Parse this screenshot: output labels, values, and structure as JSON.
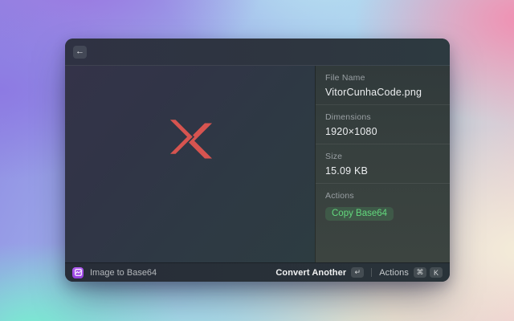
{
  "window": {
    "header": {
      "back_glyph": "←"
    },
    "preview": {
      "logo_color": "#d75450",
      "logo_name": "chevrons-x-logo"
    },
    "metadata": {
      "file_name": {
        "label": "File Name",
        "value": "VitorCunhaCode.png"
      },
      "dimensions": {
        "label": "Dimensions",
        "value": "1920×1080"
      },
      "size": {
        "label": "Size",
        "value": "15.09 KB"
      },
      "actions": {
        "label": "Actions",
        "button": "Copy Base64"
      }
    },
    "footer": {
      "command_name": "Image to Base64",
      "primary_action": "Convert Another",
      "primary_key": "↵",
      "secondary_action": "Actions",
      "secondary_keys": {
        "cmd": "⌘",
        "k": "K"
      }
    }
  },
  "colors": {
    "copy_button_green": "#63d97d",
    "logo_red": "#d75450",
    "app_icon_purple": "#9c48e2",
    "window_bg": "#2e3440"
  },
  "icons": {
    "back": "arrow-left-icon",
    "app_badge": "image-icon",
    "return_key": "return-icon",
    "command_key": "command-icon"
  }
}
